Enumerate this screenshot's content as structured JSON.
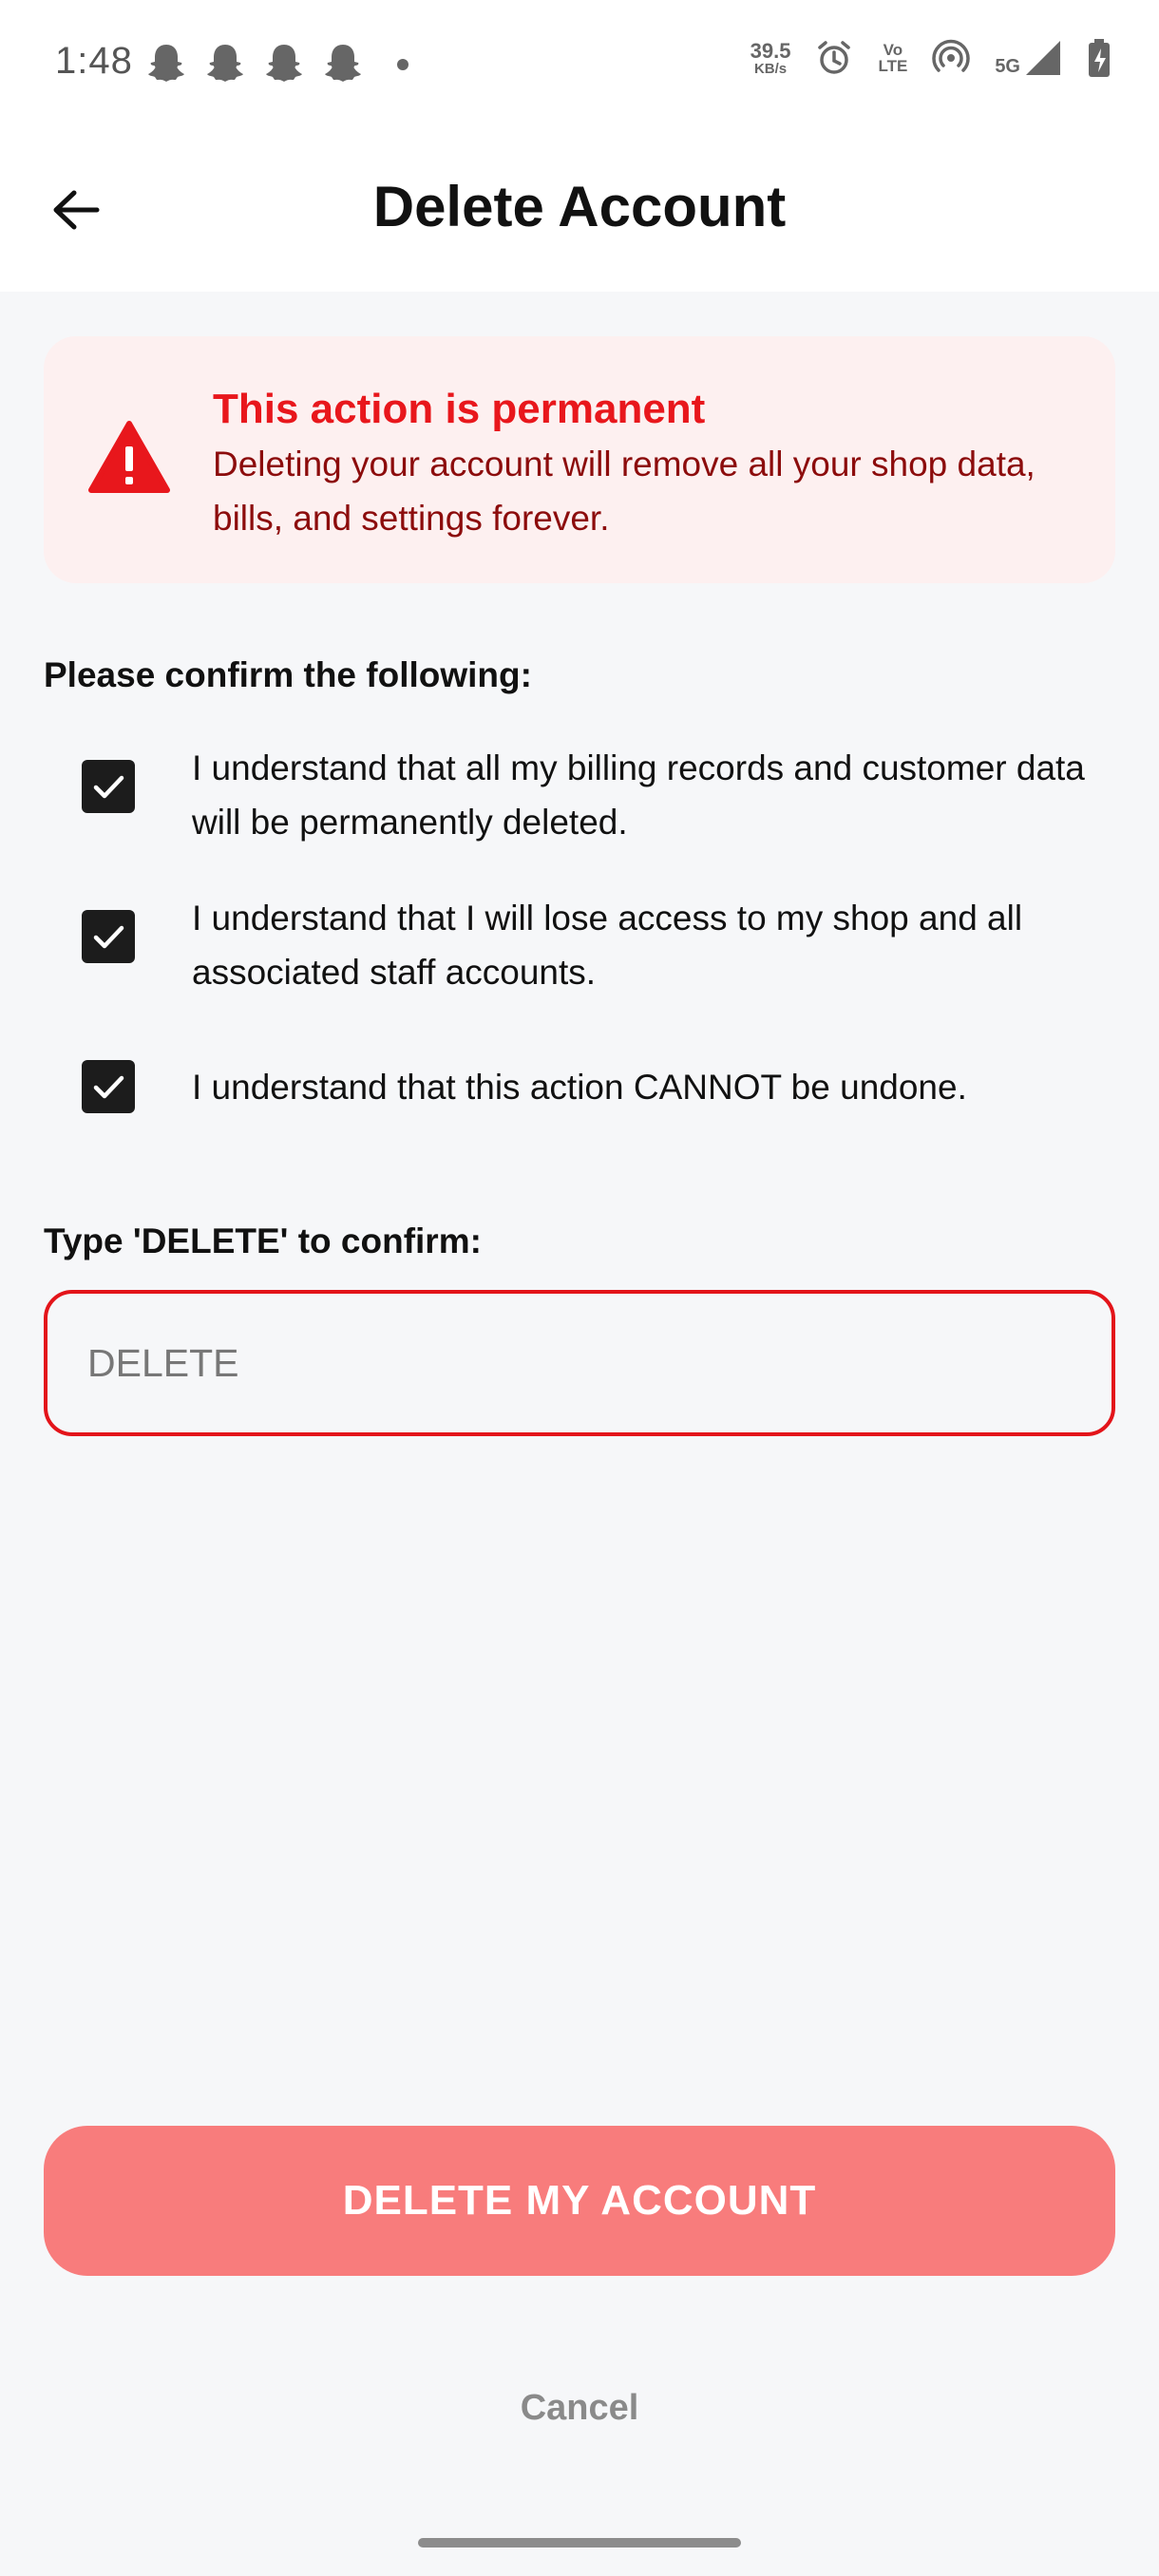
{
  "status_bar": {
    "time": "1:48",
    "net_speed_value": "39.5",
    "net_speed_unit": "KB/s",
    "volte_top": "Vo",
    "volte_bottom": "LTE",
    "network": "5G",
    "notification_icons": [
      "snapchat-icon",
      "snapchat-icon",
      "snapchat-icon",
      "snapchat-icon"
    ]
  },
  "header": {
    "title": "Delete Account",
    "back_icon": "arrow-left-icon"
  },
  "warning": {
    "icon": "warning-triangle-icon",
    "title": "This action is permanent",
    "text": "Deleting your account will remove all your shop data, bills, and settings forever."
  },
  "confirm": {
    "heading": "Please confirm the following:",
    "items": [
      {
        "label": "I understand that all my billing records and customer data will be permanently deleted.",
        "checked": true
      },
      {
        "label": "I understand that I will lose access to my shop and all associated staff accounts.",
        "checked": true
      },
      {
        "label": "I understand that this action CANNOT be undone.",
        "checked": true
      }
    ]
  },
  "type_confirm": {
    "label": "Type 'DELETE' to confirm:",
    "placeholder": "DELETE",
    "value": ""
  },
  "actions": {
    "delete_label": "DELETE MY ACCOUNT",
    "cancel_label": "Cancel"
  },
  "colors": {
    "accent_red": "#e8171c",
    "warning_bg": "#fdf0f0",
    "button_disabled_red": "#f87c7c"
  }
}
